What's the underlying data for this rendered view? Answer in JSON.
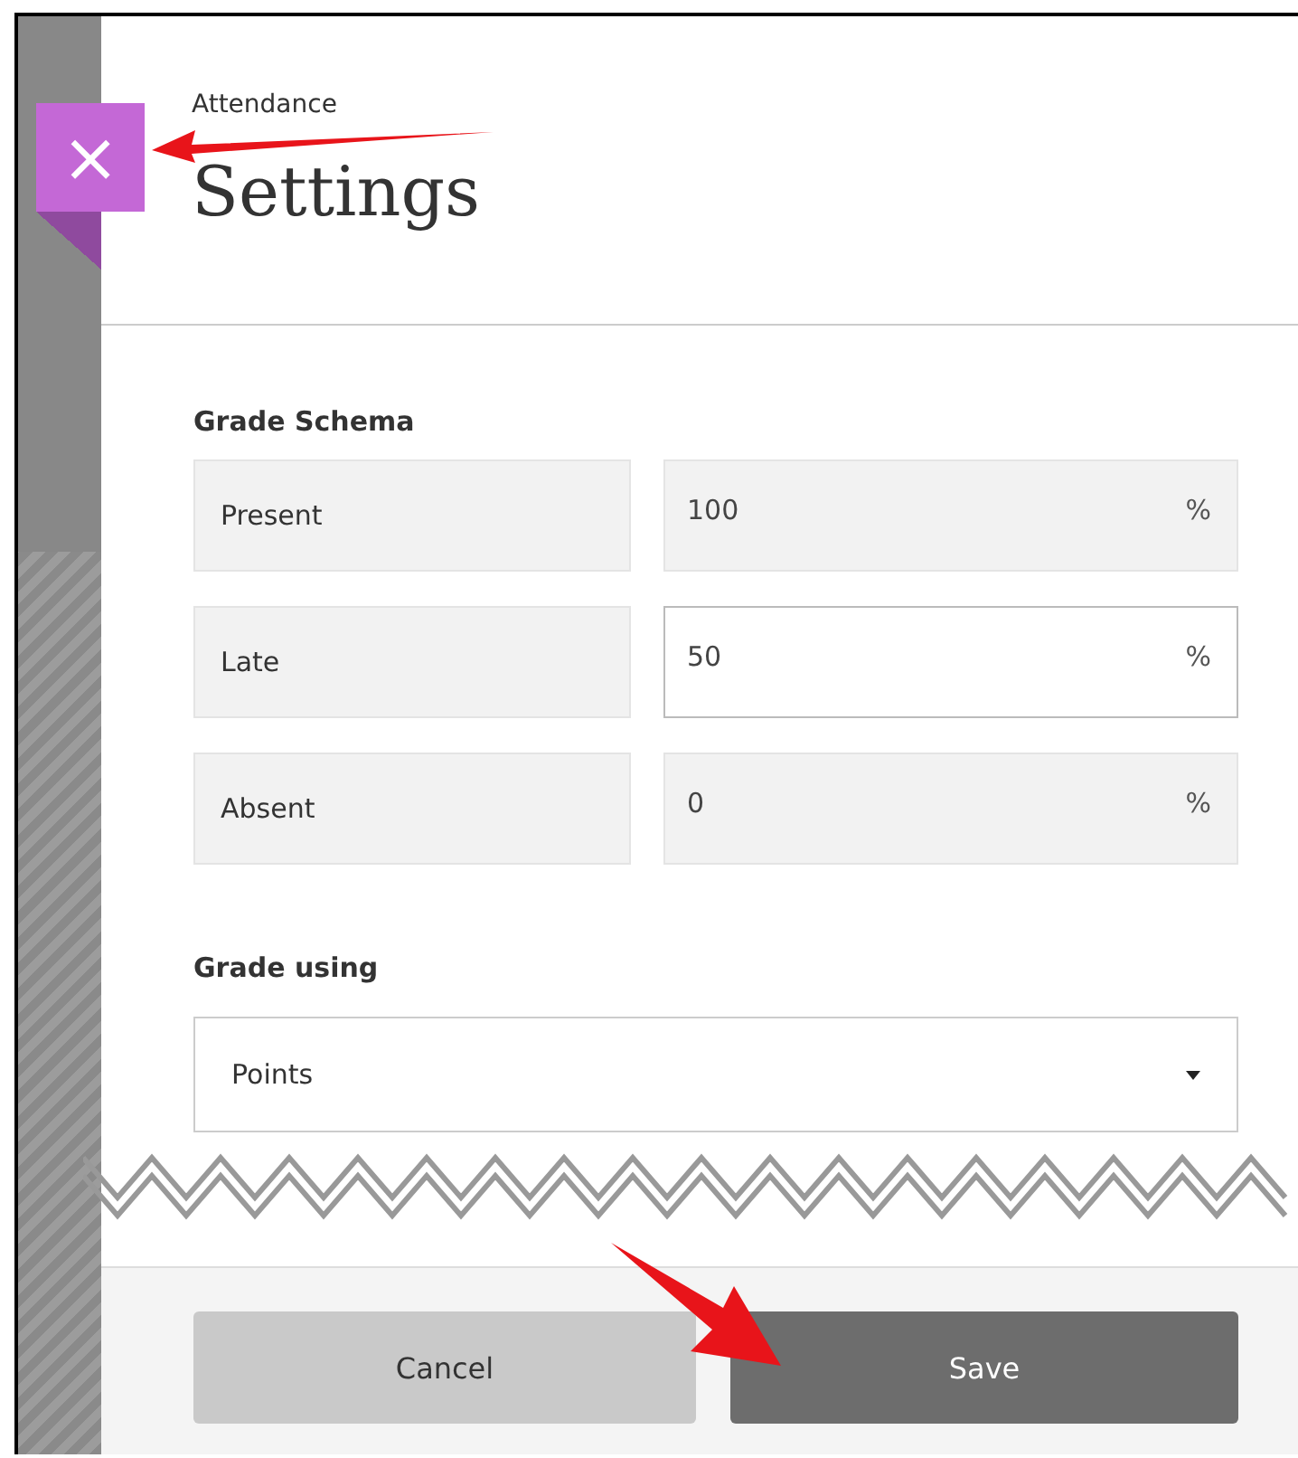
{
  "panel": {
    "close_glyph": "×",
    "subtitle": "Attendance",
    "title": "Settings"
  },
  "grade_schema": {
    "heading": "Grade Schema",
    "rows": [
      {
        "label": "Present",
        "value": "100",
        "unit": "%",
        "focused": false
      },
      {
        "label": "Late",
        "value": "50",
        "unit": "%",
        "focused": true
      },
      {
        "label": "Absent",
        "value": "0",
        "unit": "%",
        "focused": false
      }
    ]
  },
  "grade_using": {
    "heading": "Grade using",
    "value": "Points"
  },
  "buttons": [
    {
      "label": "Cancel",
      "kind": "secondary"
    },
    {
      "label": "Save",
      "kind": "primary"
    }
  ]
}
